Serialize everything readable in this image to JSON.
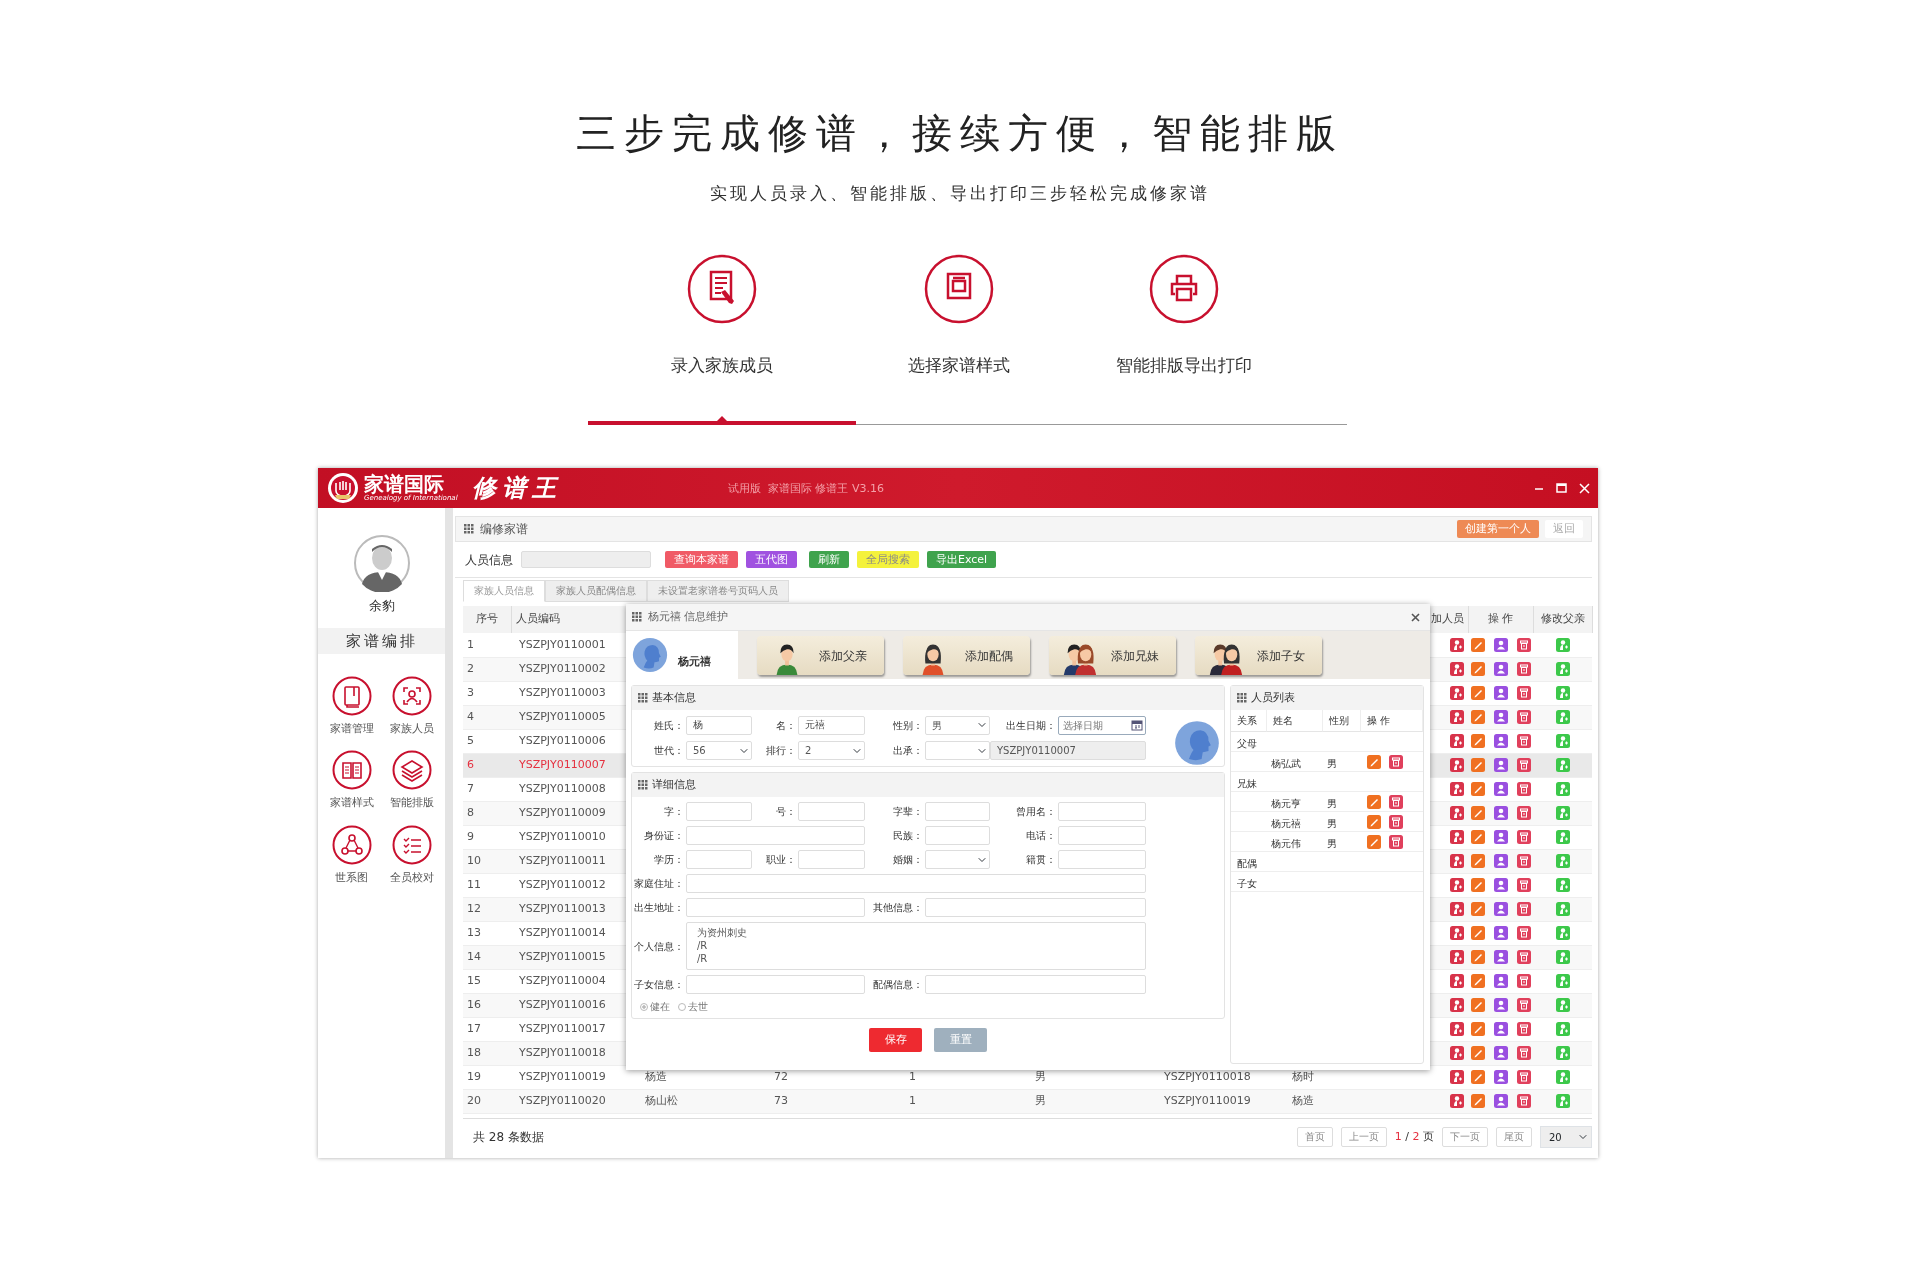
{
  "header": {
    "title": "三步完成修谱，接续方便，智能排版",
    "subtitle": "实现人员录入、智能排版、导出打印三步轻松完成修家谱"
  },
  "steps": [
    {
      "label": "录入家族成员",
      "selected": true
    },
    {
      "label": "选择家谱样式",
      "selected": false
    },
    {
      "label": "智能排版导出打印",
      "selected": false
    }
  ],
  "window": {
    "brand": "家谱国际",
    "brand_en": "Genealogy of International",
    "product": "修谱王",
    "version_text": "试用版  家谱国际 修谱王 V3.16"
  },
  "sidebar": {
    "user": "余豹",
    "section": "家谱编排",
    "items": [
      {
        "label": "家谱管理"
      },
      {
        "label": "家族人员"
      },
      {
        "label": "家谱样式"
      },
      {
        "label": "智能排版"
      },
      {
        "label": "世系图"
      },
      {
        "label": "全员校对"
      }
    ]
  },
  "panel": {
    "title": "编修家谱",
    "actions": [
      {
        "label": "创建第一个人",
        "kind": "primary"
      },
      {
        "label": "返回",
        "kind": "plain"
      }
    ]
  },
  "search": {
    "label": "人员信息",
    "buttons": [
      {
        "label": "查询本家谱",
        "color": "#f05a66"
      },
      {
        "label": "五代图",
        "color": "#a052e0"
      },
      {
        "label": "刷新",
        "color": "#3fa34d"
      },
      {
        "label": "全局搜索",
        "color": "#f4f23c"
      },
      {
        "label": "导出Excel",
        "color": "#3fa34d"
      }
    ]
  },
  "tabs": [
    {
      "label": "家族人员信息",
      "selected": true
    },
    {
      "label": "家族人员配偶信息",
      "selected": false
    },
    {
      "label": "未设置老家谱卷号页码人员",
      "selected": false
    }
  ],
  "table": {
    "columns": [
      "序号",
      "人员编码",
      "加人员",
      "操 作",
      "修改父亲"
    ],
    "rows": [
      {
        "cells": [
          "1",
          "YSZPJY0110001"
        ],
        "selected": false
      },
      {
        "cells": [
          "2",
          "YSZPJY0110002"
        ],
        "selected": false
      },
      {
        "cells": [
          "3",
          "YSZPJY0110003"
        ],
        "selected": false
      },
      {
        "cells": [
          "4",
          "YSZPJY0110005"
        ],
        "selected": false
      },
      {
        "cells": [
          "5",
          "YSZPJY0110006"
        ],
        "selected": false
      },
      {
        "cells": [
          "6",
          "YSZPJY0110007"
        ],
        "selected": true
      },
      {
        "cells": [
          "7",
          "YSZPJY0110008"
        ],
        "selected": false
      },
      {
        "cells": [
          "8",
          "YSZPJY0110009"
        ],
        "selected": false
      },
      {
        "cells": [
          "9",
          "YSZPJY0110010"
        ],
        "selected": false
      },
      {
        "cells": [
          "10",
          "YSZPJY0110011"
        ],
        "selected": false
      },
      {
        "cells": [
          "11",
          "YSZPJY0110012"
        ],
        "selected": false
      },
      {
        "cells": [
          "12",
          "YSZPJY0110013"
        ],
        "selected": false
      },
      {
        "cells": [
          "13",
          "YSZPJY0110014"
        ],
        "selected": false
      },
      {
        "cells": [
          "14",
          "YSZPJY0110015"
        ],
        "selected": false
      },
      {
        "cells": [
          "15",
          "YSZPJY0110004"
        ],
        "selected": false
      },
      {
        "cells": [
          "16",
          "YSZPJY0110016"
        ],
        "selected": false
      },
      {
        "cells": [
          "17",
          "YSZPJY0110017"
        ],
        "selected": false
      },
      {
        "cells": [
          "18",
          "YSZPJY0110018"
        ],
        "selected": false
      },
      {
        "cells": [
          "19",
          "YSZPJY0110019",
          "杨造",
          "72",
          "1",
          "男",
          "YSZPJY0110018",
          "杨时"
        ],
        "selected": false
      },
      {
        "cells": [
          "20",
          "YSZPJY0110020",
          "杨山松",
          "73",
          "1",
          "男",
          "YSZPJY0110019",
          "杨造"
        ],
        "selected": false
      }
    ]
  },
  "footer": {
    "total": "共 28 条数据",
    "first": "首页",
    "prev": "上一页",
    "current_page": "1",
    "separator": "/",
    "total_pages": "2",
    "page_unit": "页",
    "next": "下一页",
    "last": "尾页",
    "page_size": "20"
  },
  "dialog": {
    "title": "杨元禧 信息维护",
    "person_name": "杨元禧",
    "add_buttons": [
      "添加父亲",
      "添加配偶",
      "添加兄妹",
      "添加子女"
    ],
    "basic": {
      "title": "基本信息",
      "fields": [
        {
          "label": "姓氏：",
          "value": "杨",
          "kind": "text"
        },
        {
          "label": "名：",
          "value": "元禧",
          "kind": "text"
        },
        {
          "label": "性别：",
          "value": "男",
          "kind": "select"
        },
        {
          "label": "出生日期：",
          "placeholder": "选择日期",
          "kind": "date"
        },
        {
          "label": "世代：",
          "value": "56",
          "kind": "select"
        },
        {
          "label": "排行：",
          "value": "2",
          "kind": "select"
        },
        {
          "label": "出承：",
          "kind": "select"
        },
        {
          "value": "YSZPJY0110007",
          "kind": "readonly"
        }
      ]
    },
    "detail": {
      "title": "详细信息",
      "fields": [
        {
          "label": "字：",
          "kind": "text"
        },
        {
          "label": "号：",
          "kind": "text"
        },
        {
          "label": "字辈：",
          "kind": "text"
        },
        {
          "label": "曾用名：",
          "kind": "text"
        },
        {
          "label": "身份证：",
          "kind": "wide"
        },
        {
          "label": "民族：",
          "kind": "text"
        },
        {
          "label": "电话：",
          "kind": "text"
        },
        {
          "label": "学历：",
          "kind": "text"
        },
        {
          "label": "职业：",
          "kind": "text"
        },
        {
          "label": "婚姻：",
          "kind": "select"
        },
        {
          "label": "籍贯：",
          "kind": "text"
        },
        {
          "label": "家庭住址：",
          "kind": "full"
        },
        {
          "label": "出生地址：",
          "kind": "wide"
        },
        {
          "label": "其他信息：",
          "kind": "wide"
        },
        {
          "label": "个人信息：",
          "value": "为资州刺史\n/R\n/R",
          "kind": "textarea"
        },
        {
          "label": "子女信息：",
          "kind": "wide"
        },
        {
          "label": "配偶信息：",
          "kind": "wide"
        }
      ]
    },
    "status": [
      {
        "label": "健在",
        "selected": true
      },
      {
        "label": "去世",
        "selected": false
      }
    ],
    "buttons": [
      {
        "label": "保存",
        "kind": "save"
      },
      {
        "label": "重置",
        "kind": "reset"
      }
    ],
    "person_list": {
      "title": "人员列表",
      "columns": [
        "关系",
        "姓名",
        "性别",
        "操 作"
      ],
      "groups": [
        {
          "label": "父母",
          "children": [
            {
              "name": "杨弘武",
              "gender": "男"
            }
          ]
        },
        {
          "label": "兄妹",
          "children": [
            {
              "name": "杨元亨",
              "gender": "男"
            },
            {
              "name": "杨元禧",
              "gender": "男"
            },
            {
              "name": "杨元伟",
              "gender": "男"
            }
          ]
        },
        {
          "label": "配偶"
        },
        {
          "label": "子女"
        }
      ]
    }
  }
}
